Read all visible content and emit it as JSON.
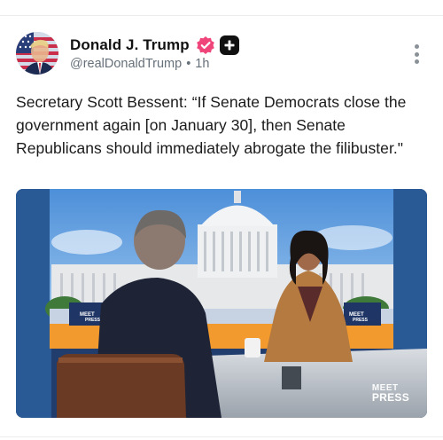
{
  "post": {
    "author": {
      "display_name": "Donald J. Trump",
      "handle": "@realDonaldTrump",
      "time_ago": "1h",
      "separator": "•",
      "avatar_icon": "flag-portrait-avatar",
      "verified_icon": "verified-check-icon",
      "verified_color": "#f0457a",
      "plus_icon": "plus-badge-icon"
    },
    "menu_icon": "more-vertical-icon",
    "text": "Secretary Scott Bessent: “If Senate Democrats close the government again [on January 30], then Senate Republicans should immediately abrogate the filibuster.\"",
    "media": {
      "type": "video-still",
      "watermark_left": "MEET THE PRESS",
      "watermark_right_line1": "MEET",
      "watermark_right_line2": "PRESS",
      "backdrop_label_right": "MEET PRESS"
    }
  }
}
